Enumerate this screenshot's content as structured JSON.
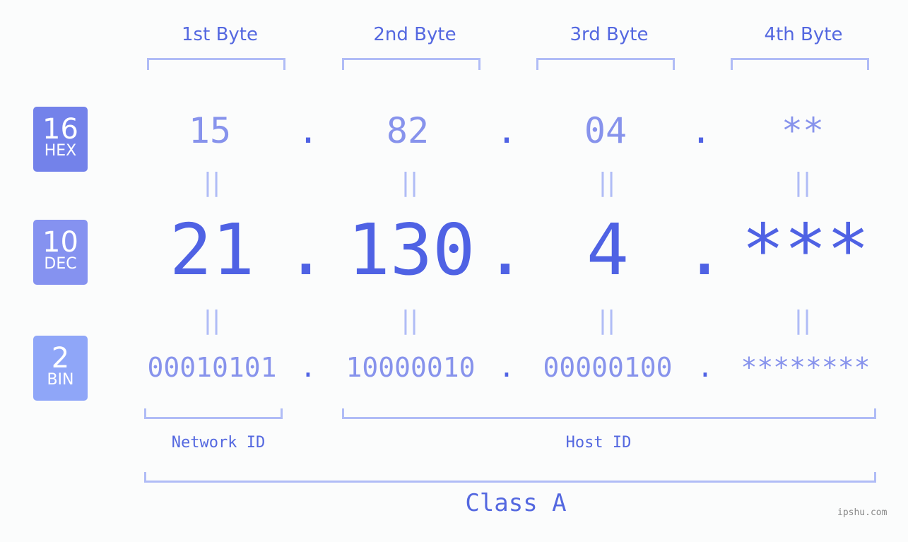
{
  "headers": [
    "1st Byte",
    "2nd Byte",
    "3rd Byte",
    "4th Byte"
  ],
  "badges": [
    {
      "num": "16",
      "label": "HEX",
      "color": "#7382ea"
    },
    {
      "num": "10",
      "label": "DEC",
      "color": "#8592f0"
    },
    {
      "num": "2",
      "label": "BIN",
      "color": "#8fa6f8"
    }
  ],
  "hex": [
    "15",
    "82",
    "04",
    "**"
  ],
  "dec": [
    "21",
    "130",
    "4",
    "***"
  ],
  "bin": [
    "00010101",
    "10000010",
    "00000100",
    "********"
  ],
  "separator": ".",
  "equals": "||",
  "network_label": "Network ID",
  "host_label": "Host ID",
  "class_label": "Class A",
  "footer": "ipshu.com"
}
